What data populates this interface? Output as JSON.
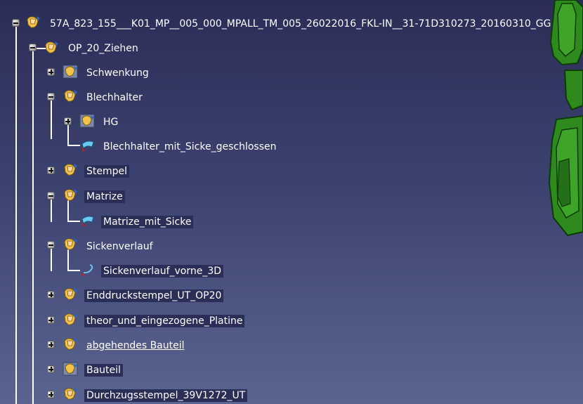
{
  "tree": {
    "root": {
      "label": "57A_823_155___K01_MP__005_000_MPALL_TM_005_26022016_FKL-IN__31-71D310273_20160310_GG"
    },
    "op20": {
      "label": "OP_20_Ziehen"
    },
    "items": [
      {
        "label": "Schwenkung"
      },
      {
        "label": "Blechhalter"
      },
      {
        "label": "HG"
      },
      {
        "label": "Blechhalter_mit_Sicke_geschlossen"
      },
      {
        "label": "Stempel"
      },
      {
        "label": "Matrize"
      },
      {
        "label": "Matrize_mit_Sicke"
      },
      {
        "label": "Sickenverlauf"
      },
      {
        "label": "Sickenverlauf_vorne_3D"
      },
      {
        "label": "Enddruckstempel_UT_OP20"
      },
      {
        "label": "theor_und_eingezogene_Platine"
      },
      {
        "label": "abgehendes Bauteil"
      },
      {
        "label": "Bauteil"
      },
      {
        "label": "Durchzugsstempel_39V1272_UT"
      }
    ]
  },
  "colors": {
    "background_top": "#2a2d56",
    "background_bottom": "#5b6490",
    "geometry_green": "#2f8a1e",
    "text": "#ffffff"
  }
}
